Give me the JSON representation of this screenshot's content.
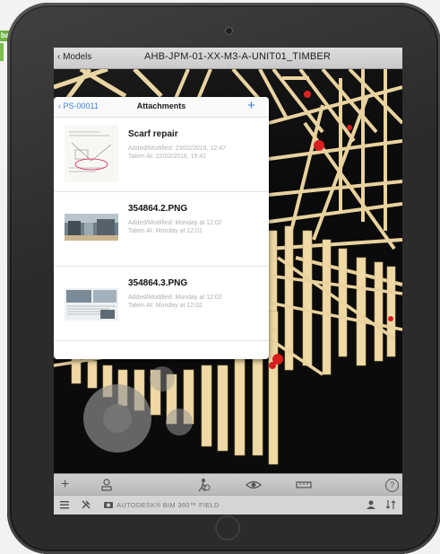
{
  "window": {
    "back_label": "Models",
    "title": "AHB-JPM-01-XX-M3-A-UNIT01_TIMBER"
  },
  "side_tab": {
    "label": "ba"
  },
  "popover": {
    "back_label": "PS-00011",
    "title": "Attachments",
    "add_label": "+",
    "items": [
      {
        "name": "Scarf repair",
        "added": "Added/Modified: 23/02/2016, 12:47",
        "taken": "Taken At: 22/02/2016, 15:42",
        "thumb": "sketch"
      },
      {
        "name": "354864.2.PNG",
        "added": "Added/Modified: Monday at 12:02",
        "taken": "Taken At: Monday at 12:01",
        "thumb": "photo"
      },
      {
        "name": "354864.3.PNG",
        "added": "Added/Modified: Monday at 12:02",
        "taken": "Taken At: Monday at 12:02",
        "thumb": "document"
      }
    ]
  },
  "toolbar": {
    "icons": [
      "plus-icon",
      "user-stamp-icon",
      "walk-icon",
      "eye-icon",
      "measure-icon",
      "help-icon"
    ],
    "plus": "+",
    "help": "?"
  },
  "status": {
    "brand": "AUTODESK® BIM 360™ FIELD",
    "icons": [
      "menu-icon",
      "tools-icon",
      "camera-icon",
      "user-icon",
      "sync-icon"
    ]
  },
  "colors": {
    "accent": "#2d7ad6",
    "timber": "#f0d9a6",
    "issue_marker": "#d81e1e",
    "brand_green": "#6db33f"
  }
}
